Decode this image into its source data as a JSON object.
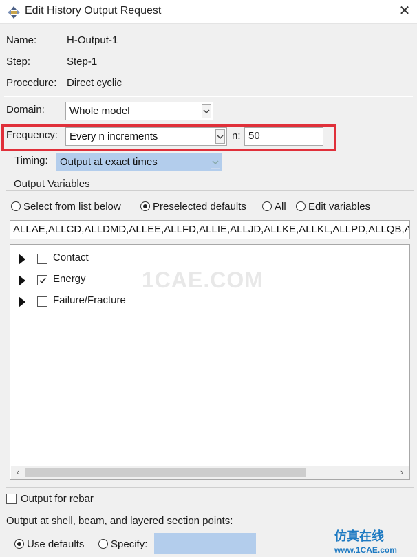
{
  "window": {
    "title": "Edit History Output Request",
    "close_glyph": "✕",
    "icon": "abaqus-output-icon"
  },
  "info": {
    "name_label": "Name:",
    "name_value": "H-Output-1",
    "step_label": "Step:",
    "step_value": "Step-1",
    "procedure_label": "Procedure:",
    "procedure_value": "Direct cyclic"
  },
  "domain": {
    "label": "Domain:",
    "value": "Whole model"
  },
  "frequency": {
    "label": "Frequency:",
    "value": "Every n increments",
    "n_label": "n:",
    "n_value": "50",
    "highlight_color": "#e0303a"
  },
  "timing": {
    "label": "Timing:",
    "value": "Output at exact times"
  },
  "output_variables": {
    "title": "Output Variables",
    "options": [
      {
        "label": "Select from list below",
        "selected": false
      },
      {
        "label": "Preselected defaults",
        "selected": true
      },
      {
        "label": "All",
        "selected": false
      },
      {
        "label": "Edit variables",
        "selected": false
      }
    ],
    "variables_text": "ALLAE,ALLCD,ALLDMD,ALLEE,ALLFD,ALLIE,ALLJD,ALLKE,ALLKL,ALLPD,ALLQB,ALLS",
    "tree": [
      {
        "label": "Contact",
        "checked": false
      },
      {
        "label": "Energy",
        "checked": true
      },
      {
        "label": "Failure/Fracture",
        "checked": false
      }
    ]
  },
  "rebar": {
    "label": "Output for rebar",
    "checked": false
  },
  "section_points": {
    "label": "Output at shell, beam, and layered section points:",
    "use_defaults": "Use defaults",
    "specify": "Specify:",
    "specify_value": ""
  },
  "watermark": {
    "text": "1CAE.COM",
    "brand": "仿真在线",
    "brand_url": "www.1CAE.com"
  },
  "colors": {
    "panel": "#f0f0f0",
    "disabled_field": "#b3cdec",
    "brand": "#1e7ac2"
  }
}
